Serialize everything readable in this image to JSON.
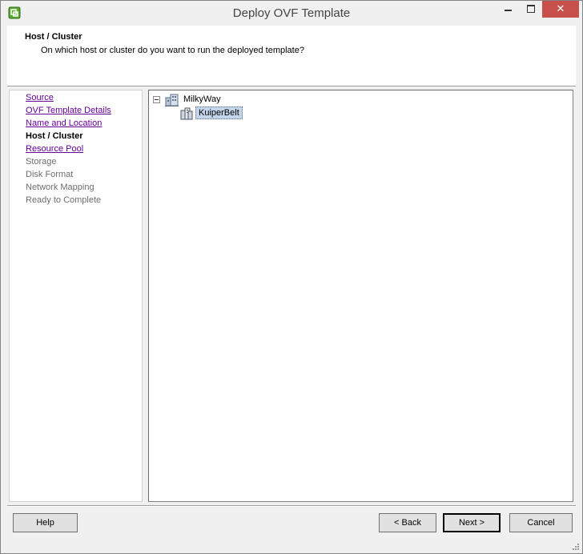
{
  "window": {
    "title": "Deploy OVF Template",
    "close_glyph": "✕"
  },
  "header": {
    "title": "Host / Cluster",
    "subtitle": "On which host or cluster do you want to run the deployed template?"
  },
  "steps": [
    {
      "label": "Source",
      "state": "link"
    },
    {
      "label": "OVF Template Details",
      "state": "link"
    },
    {
      "label": "Name and Location",
      "state": "link"
    },
    {
      "label": "Host / Cluster",
      "state": "current"
    },
    {
      "label": "Resource Pool",
      "state": "link"
    },
    {
      "label": "Storage",
      "state": "disabled"
    },
    {
      "label": "Disk Format",
      "state": "disabled"
    },
    {
      "label": "Network Mapping",
      "state": "disabled"
    },
    {
      "label": "Ready to Complete",
      "state": "disabled"
    }
  ],
  "tree": {
    "datacenter": "MilkyWay",
    "cluster": "KuiperBelt"
  },
  "buttons": {
    "help": "Help",
    "back": "< Back",
    "next": "Next >",
    "cancel": "Cancel"
  },
  "colors": {
    "link": "#660099",
    "selection": "#c2d5ea",
    "close_button": "#c7514a"
  }
}
